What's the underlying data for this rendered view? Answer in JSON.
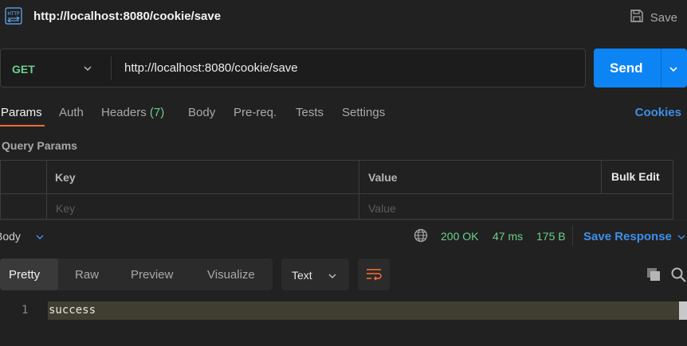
{
  "request": {
    "title": "http://localhost:8080/cookie/save",
    "save_label": "Save",
    "method": "GET",
    "url": "http://localhost:8080/cookie/save",
    "send_label": "Send"
  },
  "tabs": [
    {
      "label": "Params"
    },
    {
      "label": "Auth"
    },
    {
      "label": "Headers",
      "count": "(7)"
    },
    {
      "label": "Body"
    },
    {
      "label": "Pre-req."
    },
    {
      "label": "Tests"
    },
    {
      "label": "Settings"
    }
  ],
  "cookies_label": "Cookies",
  "query_params": {
    "title": "Query Params",
    "col_key": "Key",
    "col_value": "Value",
    "bulk_edit": "Bulk Edit",
    "key_placeholder": "Key",
    "value_placeholder": "Value"
  },
  "response": {
    "body_label": "Body",
    "status": "200 OK",
    "time": "47 ms",
    "size": "175 B",
    "save_response": "Save Response",
    "views": [
      "Pretty",
      "Raw",
      "Preview",
      "Visualize"
    ],
    "format": "Text",
    "line_number": "1",
    "content": "success"
  },
  "colors": {
    "accent_orange": "#ff6c37",
    "send_blue": "#0d84f4",
    "status_green": "#6ccf8d",
    "link_blue": "#3e8fe8"
  }
}
